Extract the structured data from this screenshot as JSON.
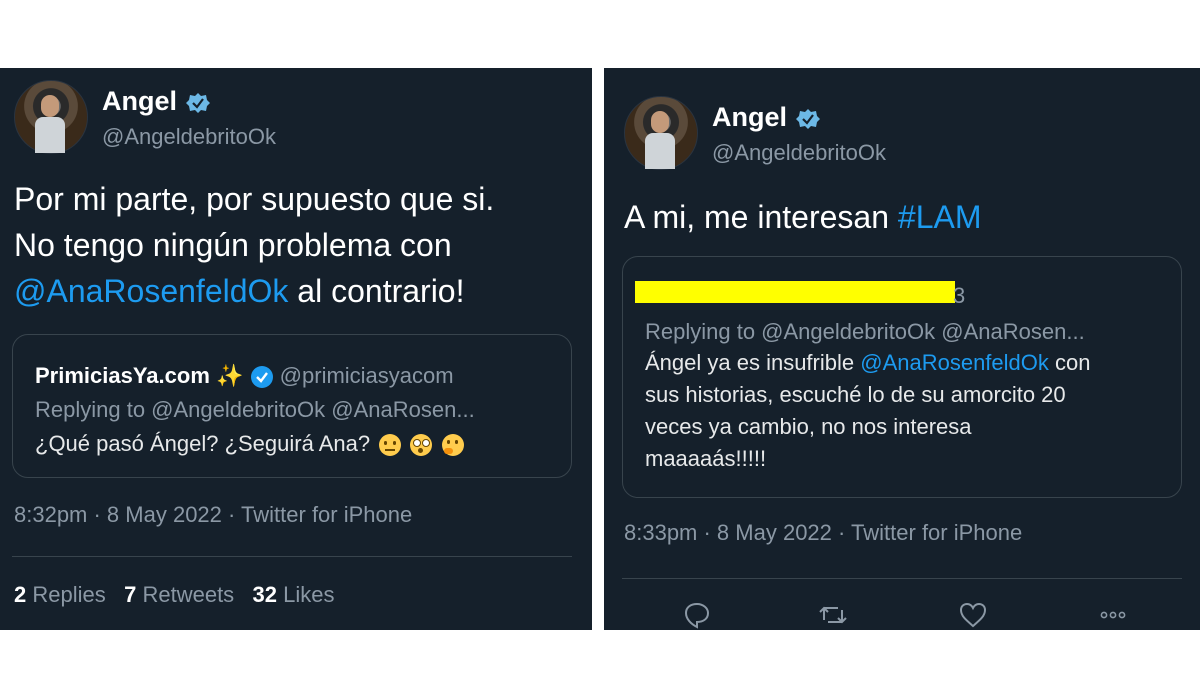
{
  "tweet1": {
    "name": "Angel",
    "handle": "@AngeldebritoOk",
    "text_line1": "Por mi parte, por supuesto que si.",
    "text_line2": "No tengo ningún problema con",
    "mention": "@AnaRosenfeldOk",
    "text_line3_end": " al contrario!",
    "quote": {
      "name": "PrimiciasYa.com",
      "sparkle": "✨",
      "handle": "@primiciasyacom",
      "replying": "Replying to @AngeldebritoOk @AnaRosen...",
      "text": "¿Qué pasó Ángel? ¿Seguirá Ana?"
    },
    "meta": "8:32pm · 8 May 2022 · Twitter for iPhone",
    "stats": {
      "replies_count": "2",
      "replies_label": "Replies",
      "retweets_count": "7",
      "retweets_label": "Retweets",
      "likes_count": "32",
      "likes_label": "Likes"
    }
  },
  "tweet2": {
    "name": "Angel",
    "handle": "@AngeldebritoOk",
    "text_prefix": "A mi, me interesan ",
    "hashtag": "#LAM",
    "quote": {
      "name_suffix": "3",
      "replying": "Replying to @AngeldebritoOk @AnaRosen...",
      "line1_prefix": "Ángel ya es insufrible ",
      "line1_mention": "@AnaRosenfeldOk",
      "line1_suffix": " con",
      "line2": "sus historias, escuché lo de su amorcito 20",
      "line3": "veces ya cambio, no nos interesa",
      "line4": "maaaaás!!!!!"
    },
    "meta": "8:33pm · 8 May 2022 · Twitter for iPhone",
    "actions": [
      "reply-icon",
      "retweet-icon",
      "like-icon",
      "more-icon"
    ]
  },
  "colors": {
    "card_bg": "#15202b",
    "link": "#1d9bf0",
    "muted": "#8b98a5",
    "redaction": "#ffff00",
    "verified": "#1d9bf0"
  }
}
